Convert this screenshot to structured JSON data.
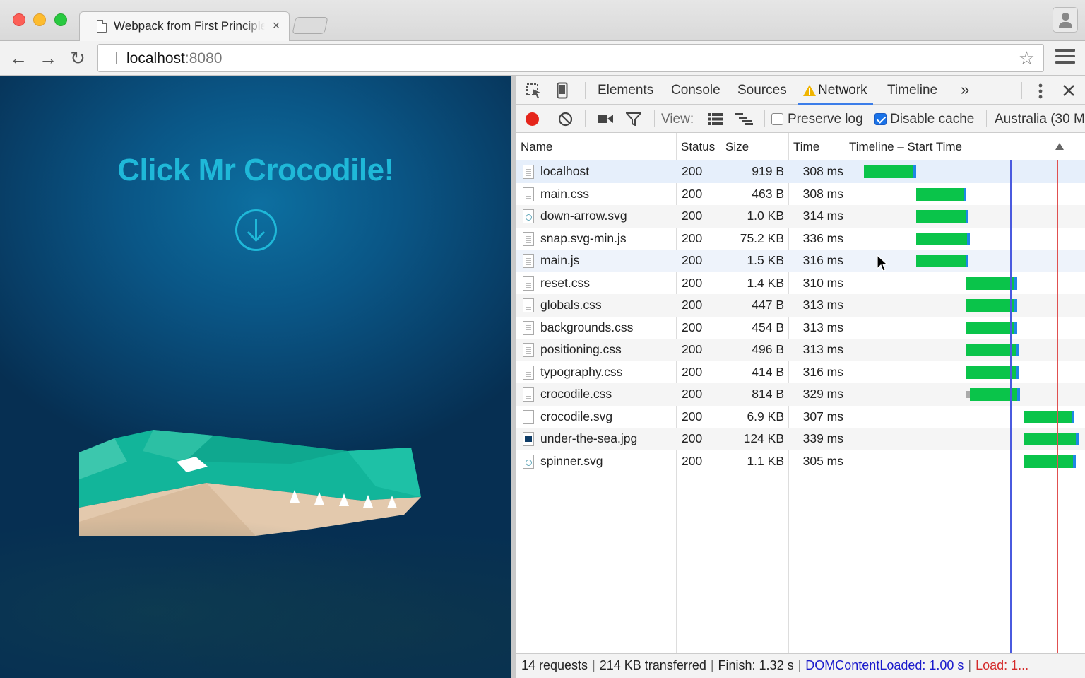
{
  "window": {
    "tab_title": "Webpack from First Principles",
    "tab_close": "×",
    "url_host": "localhost",
    "url_port": ":8080"
  },
  "page": {
    "heading": "Click Mr Crocodile!"
  },
  "devtools": {
    "tabs": {
      "elements": "Elements",
      "console": "Console",
      "sources": "Sources",
      "network": "Network",
      "timeline": "Timeline",
      "more": "»"
    },
    "network_bar": {
      "view_label": "View:",
      "preserve_log": "Preserve log",
      "preserve_log_checked": false,
      "disable_cache": "Disable cache",
      "disable_cache_checked": true,
      "throttle": "Australia (30 M"
    },
    "columns": {
      "name": "Name",
      "status": "Status",
      "size": "Size",
      "time": "Time",
      "timeline": "Timeline – Start Time"
    },
    "rows": [
      {
        "name": "localhost",
        "status": "200",
        "size": "919 B",
        "time": "308 ms",
        "icon": "doc",
        "start": 0.03,
        "end": 0.36,
        "wait": 0
      },
      {
        "name": "main.css",
        "status": "200",
        "size": "463 B",
        "time": "308 ms",
        "icon": "doc",
        "start": 0.36,
        "end": 0.68,
        "wait": 0
      },
      {
        "name": "down-arrow.svg",
        "status": "200",
        "size": "1.0 KB",
        "time": "314 ms",
        "icon": "svg",
        "start": 0.36,
        "end": 0.69,
        "wait": 0
      },
      {
        "name": "snap.svg-min.js",
        "status": "200",
        "size": "75.2 KB",
        "time": "336 ms",
        "icon": "doc",
        "start": 0.36,
        "end": 0.7,
        "wait": 0
      },
      {
        "name": "main.js",
        "status": "200",
        "size": "1.5 KB",
        "time": "316 ms",
        "icon": "doc",
        "start": 0.36,
        "end": 0.69,
        "wait": 0
      },
      {
        "name": "reset.css",
        "status": "200",
        "size": "1.4 KB",
        "time": "310 ms",
        "icon": "doc",
        "start": 0.68,
        "end": 1.0,
        "wait": 0
      },
      {
        "name": "globals.css",
        "status": "200",
        "size": "447 B",
        "time": "313 ms",
        "icon": "doc",
        "start": 0.68,
        "end": 1.0,
        "wait": 0
      },
      {
        "name": "backgrounds.css",
        "status": "200",
        "size": "454 B",
        "time": "313 ms",
        "icon": "doc",
        "start": 0.68,
        "end": 1.0,
        "wait": 0
      },
      {
        "name": "positioning.css",
        "status": "200",
        "size": "496 B",
        "time": "313 ms",
        "icon": "doc",
        "start": 0.68,
        "end": 1.01,
        "wait": 0
      },
      {
        "name": "typography.css",
        "status": "200",
        "size": "414 B",
        "time": "316 ms",
        "icon": "doc",
        "start": 0.68,
        "end": 1.01,
        "wait": 0
      },
      {
        "name": "crocodile.css",
        "status": "200",
        "size": "814 B",
        "time": "329 ms",
        "icon": "doc",
        "start": 0.7,
        "end": 1.02,
        "wait": 0.02
      },
      {
        "name": "crocodile.svg",
        "status": "200",
        "size": "6.9 KB",
        "time": "307 ms",
        "icon": "blank",
        "start": 1.04,
        "end": 1.36,
        "wait": 0
      },
      {
        "name": "under-the-sea.jpg",
        "status": "200",
        "size": "124 KB",
        "time": "339 ms",
        "icon": "img",
        "start": 1.04,
        "end": 1.39,
        "wait": 0
      },
      {
        "name": "spinner.svg",
        "status": "200",
        "size": "1.1 KB",
        "time": "305 ms",
        "icon": "svg",
        "start": 1.04,
        "end": 1.37,
        "wait": 0
      }
    ],
    "status_bar": {
      "requests": "14 requests",
      "transferred": "214 KB transferred",
      "finish": "Finish: 1.32 s",
      "dom_content_loaded": "DOMContentLoaded: 1.00 s",
      "load": "Load: 1...",
      "dcl_color": "#1a1acc",
      "load_color": "#d42a2a"
    }
  }
}
